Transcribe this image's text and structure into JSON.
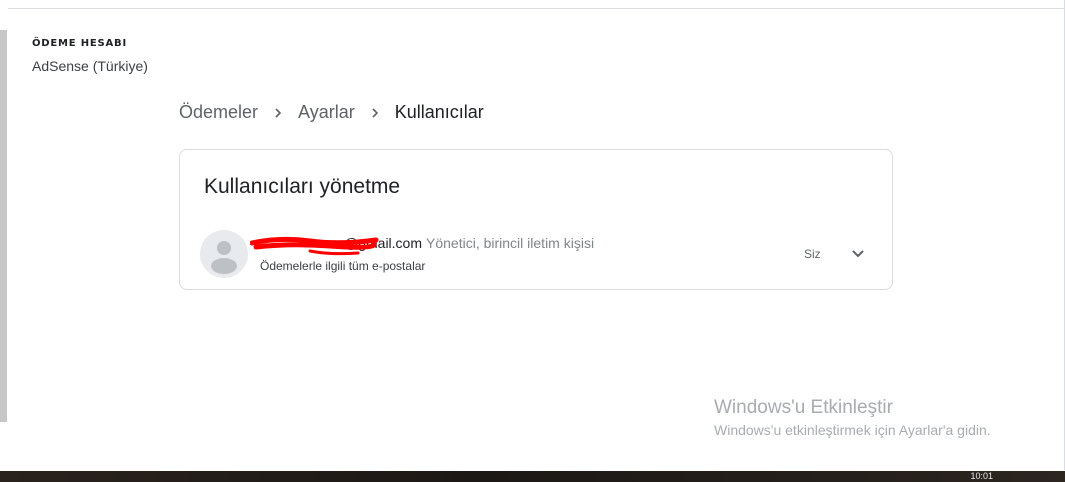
{
  "account": {
    "label": "ÖDEME HESABI",
    "name": "AdSense (Türkiye)"
  },
  "breadcrumb": {
    "items": [
      "Ödemeler",
      "Ayarlar",
      "Kullanıcılar"
    ]
  },
  "card": {
    "title": "Kullanıcıları yönetme",
    "user": {
      "email_visible": "@gmail.com",
      "role": "Yönetici, birincil iletim kişisi",
      "notifications": "Ödemelerle ilgili tüm e-postalar",
      "you_label": "Siz"
    }
  },
  "watermark": {
    "title": "Windows'u Etkinleştir",
    "subtitle": "Windows'u etkinleştirmek için Ayarlar'a gidin."
  },
  "taskbar": {
    "clock": "10:01"
  },
  "colors": {
    "redaction": "#ff0000",
    "border": "#dadce0",
    "muted_text": "#80868b"
  }
}
